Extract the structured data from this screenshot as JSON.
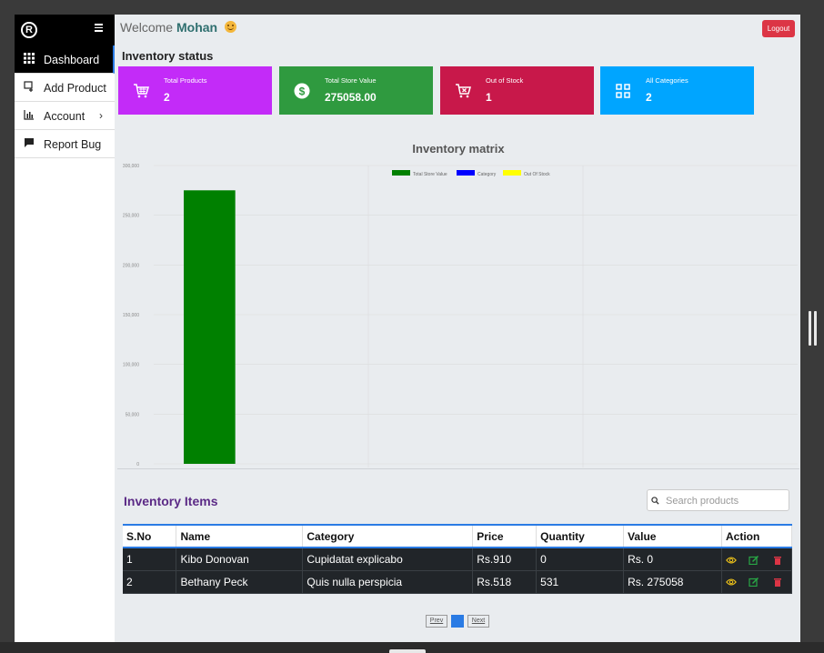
{
  "sidebar": {
    "logo_text": "R",
    "items": [
      {
        "label": "Dashboard",
        "icon": "grid-icon",
        "active": true
      },
      {
        "label": "Add Product",
        "icon": "add-product-icon"
      },
      {
        "label": "Account",
        "icon": "bar-chart-icon",
        "has_submenu": true
      },
      {
        "label": "Report Bug",
        "icon": "chat-icon"
      }
    ]
  },
  "header": {
    "welcome_text": "Welcome",
    "user_name": "Mohan",
    "logout_label": "Logout"
  },
  "status": {
    "title": "Inventory status",
    "cards": [
      {
        "label": "Total Products",
        "value": "2",
        "icon": "cart-icon",
        "color": "#c32bf8"
      },
      {
        "label": "Total Store Value",
        "value": "275058.00",
        "icon": "dollar-icon",
        "color": "#2f9a3f"
      },
      {
        "label": "Out of Stock",
        "value": "1",
        "icon": "cart-x-icon",
        "color": "#c8184a"
      },
      {
        "label": "All Categories",
        "value": "2",
        "icon": "categories-icon",
        "color": "#00a5ff"
      }
    ]
  },
  "chart_data": {
    "type": "bar",
    "title": "Inventory matrix",
    "categories": [
      "totalStoreValue",
      "category",
      "outOfStock"
    ],
    "series": [
      {
        "name": "Total Store Value",
        "color": "#008000",
        "values": [
          275058,
          0,
          0
        ]
      },
      {
        "name": "Category",
        "color": "#0000ff",
        "values": [
          0,
          2,
          0
        ]
      },
      {
        "name": "Out Of Stock",
        "color": "#ffff00",
        "values": [
          0,
          0,
          1
        ]
      }
    ],
    "yticks": [
      "0",
      "50,000",
      "100,000",
      "150,000",
      "200,000",
      "250,000",
      "300,000"
    ],
    "ylim": [
      0,
      300000
    ],
    "grid": true,
    "legend": "top"
  },
  "inventory": {
    "title": "Inventory Items",
    "search_placeholder": "Search products",
    "columns": [
      "S.No",
      "Name",
      "Category",
      "Price",
      "Quantity",
      "Value",
      "Action"
    ],
    "rows": [
      {
        "sno": "1",
        "name": "Kibo Donovan",
        "category": "Cupidatat explicabo",
        "price": "Rs.910",
        "quantity": "0",
        "value": "Rs. 0"
      },
      {
        "sno": "2",
        "name": "Bethany Peck",
        "category": "Quis nulla perspicia",
        "price": "Rs.518",
        "quantity": "531",
        "value": "Rs. 275058"
      }
    ],
    "actions": [
      {
        "icon": "eye-icon",
        "color": "#f0c419"
      },
      {
        "icon": "edit-icon",
        "color": "#28a745"
      },
      {
        "icon": "trash-icon",
        "color": "#dc3545"
      }
    ]
  },
  "pagination": {
    "prev_label": "Prev",
    "current_page": "1",
    "next_label": "Next"
  }
}
